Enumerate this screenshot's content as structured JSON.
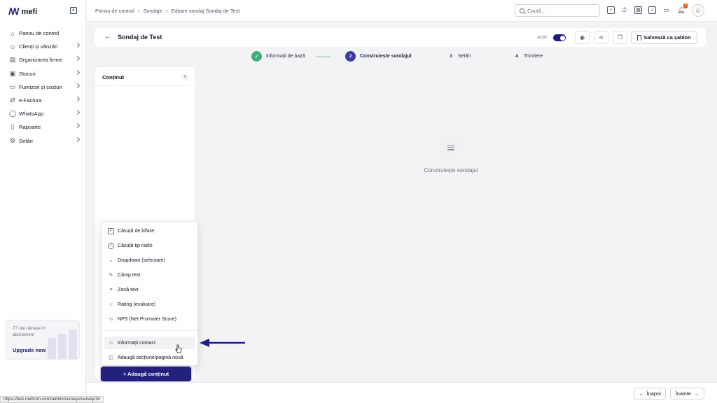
{
  "brand": {
    "name": "mefi",
    "mark": "m"
  },
  "sidebar": {
    "items": [
      {
        "label": "Panou de control",
        "icon": "home-icon",
        "glyph": "⌂",
        "has_chevron": false
      },
      {
        "label": "Clienți și vânzări",
        "icon": "users-icon",
        "glyph": "☺",
        "has_chevron": true
      },
      {
        "label": "Organizarea firmei",
        "icon": "briefcase-icon",
        "glyph": "▤",
        "has_chevron": true
      },
      {
        "label": "Stocuri",
        "icon": "box-icon",
        "glyph": "▣",
        "has_chevron": true
      },
      {
        "label": "Furnizori și costuri",
        "icon": "folder-icon",
        "glyph": "▭",
        "has_chevron": true
      },
      {
        "label": "e-Factura",
        "icon": "invoice-icon",
        "glyph": "⇄",
        "has_chevron": true
      },
      {
        "label": "WhatsApp",
        "icon": "whatsapp-icon",
        "glyph": "◯",
        "has_chevron": true
      },
      {
        "label": "Rapoarte",
        "icon": "clipboard-icon",
        "glyph": "▯",
        "has_chevron": true
      },
      {
        "label": "Setări",
        "icon": "gear-icon",
        "glyph": "⚙",
        "has_chevron": true
      }
    ],
    "upgrade": {
      "text": "77 zile rămase în abonament",
      "link": "Upgrade now →"
    }
  },
  "topbar": {
    "breadcrumbs": [
      "Panou de control",
      "Sondaje",
      "Editare sondaj Sondaj de Test"
    ],
    "search_placeholder": "Caută...",
    "notification_count": "3"
  },
  "header": {
    "title": "Sondaj de Test",
    "active_label": "Activ",
    "active": true,
    "save_template": "Salvează ca șablon"
  },
  "steps": [
    {
      "number": "✓",
      "label": "Informații de bază",
      "state": "done"
    },
    {
      "number": "2",
      "label": "Construiește sondajul",
      "state": "current"
    },
    {
      "number": "3",
      "label": "Setări",
      "state": "todo"
    },
    {
      "number": "4",
      "label": "Trimitere",
      "state": "todo"
    }
  ],
  "content_panel": {
    "title": "Conținut",
    "count": "0"
  },
  "canvas": {
    "placeholder": "Construiește sondajul"
  },
  "add_menu": {
    "items": [
      {
        "label": "Căsuță de bifare",
        "icon": "checkbox-icon"
      },
      {
        "label": "Căsuță tip radio",
        "icon": "radio-icon"
      },
      {
        "label": "Dropdown (selectare)",
        "icon": "chevron-down-icon"
      },
      {
        "label": "Câmp text",
        "icon": "edit-icon"
      },
      {
        "label": "Zonă text",
        "icon": "text-lines-icon"
      },
      {
        "label": "Rating (evaluare)",
        "icon": "star-icon"
      },
      {
        "label": "NPS (Net Promoter Score)",
        "icon": "pulse-icon"
      },
      {
        "label": "Informații contact",
        "icon": "user-icon"
      },
      {
        "label": "Adaugă secțiune/pagină nouă",
        "icon": "columns-icon"
      }
    ],
    "button": "+ Adaugă conținut"
  },
  "footer": {
    "back": "Înapoi",
    "next": "Înainte"
  },
  "status_url": "https://test.meficrm.com/admin/surveys/survey/3#",
  "colors": {
    "accent": "#23207e",
    "success": "#3fb07a",
    "warning": "#ea580c"
  }
}
